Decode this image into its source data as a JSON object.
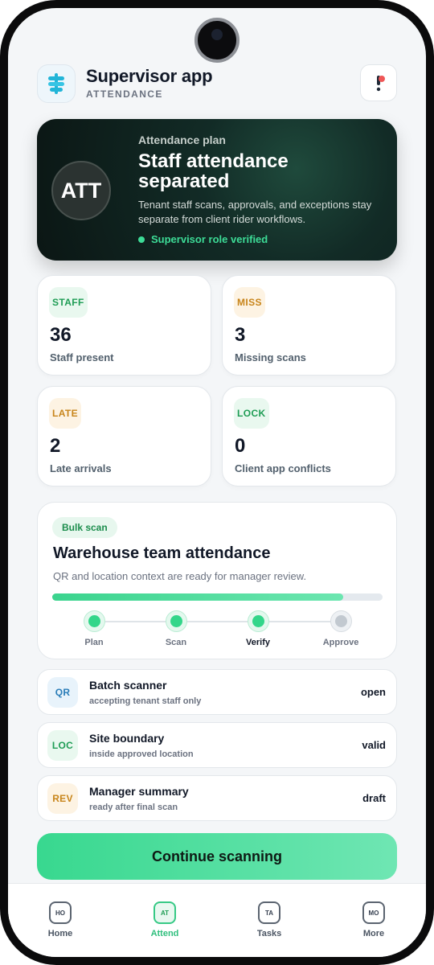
{
  "header": {
    "title": "Supervisor app",
    "subtitle": "ATTENDANCE",
    "logo_icon": "signpost-icon",
    "notification_icon": "exclamation-icon"
  },
  "hero": {
    "badge": "ATT",
    "kicker": "Attendance plan",
    "title": "Staff attendance separated",
    "description": "Tenant staff scans, approvals, and exceptions stay separate from client rider workflows.",
    "status": "Supervisor role verified"
  },
  "stats": [
    {
      "chip": "STAFF",
      "value": "36",
      "label": "Staff present"
    },
    {
      "chip": "MISS",
      "value": "3",
      "label": "Missing scans"
    },
    {
      "chip": "LATE",
      "value": "2",
      "label": "Late arrivals"
    },
    {
      "chip": "LOCK",
      "value": "0",
      "label": "Client app conflicts"
    }
  ],
  "bulk": {
    "chip": "Bulk scan",
    "title": "Warehouse team attendance",
    "description": "QR and location context are ready for manager review.",
    "progress_percent": 88,
    "steps": [
      {
        "label": "Plan",
        "state": "done"
      },
      {
        "label": "Scan",
        "state": "done"
      },
      {
        "label": "Verify",
        "state": "current"
      },
      {
        "label": "Approve",
        "state": "todo"
      }
    ]
  },
  "list": [
    {
      "icon": "QR",
      "title": "Batch scanner",
      "subtitle": "accepting tenant staff only",
      "status": "open"
    },
    {
      "icon": "LOC",
      "title": "Site boundary",
      "subtitle": "inside approved location",
      "status": "valid"
    },
    {
      "icon": "REV",
      "title": "Manager summary",
      "subtitle": "ready after final scan",
      "status": "draft"
    }
  ],
  "cta": {
    "label": "Continue scanning"
  },
  "nav": [
    {
      "icon": "HO",
      "label": "Home"
    },
    {
      "icon": "AT",
      "label": "Attend",
      "active": true
    },
    {
      "icon": "TA",
      "label": "Tasks"
    },
    {
      "icon": "MO",
      "label": "More"
    }
  ],
  "colors": {
    "accent": "#38d88f",
    "hero_bg": "#0f1f1b",
    "chip_green": "#1f9d55",
    "chip_amber": "#c8851b"
  }
}
